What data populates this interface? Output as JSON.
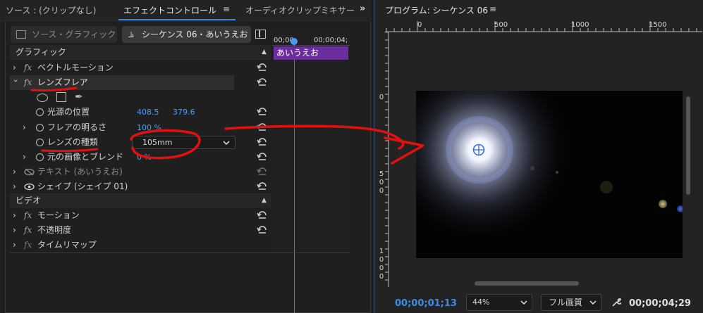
{
  "left_panel": {
    "tabs": {
      "source": "ソース : (クリップなし)",
      "effect_controls": "エフェクトコントロール",
      "audio_mixer": "オーディオクリップミキサー"
    },
    "master_clip": "ソース・グラフィック",
    "sequence_clip": "シーケンス 06・あいうえお",
    "timecodes": [
      "00;00",
      "00;00;04;"
    ],
    "clip_label": "あいうえお",
    "sections": {
      "graphic": "グラフィック",
      "video": "ビデオ"
    },
    "effects": {
      "vector_motion": "ベクトルモーション",
      "lens_flare": "レンズフレア",
      "flare_center_label": "光源の位置",
      "flare_center_x": "408.5",
      "flare_center_y": "379.6",
      "brightness_label": "フレアの明るさ",
      "brightness_value": "100 %",
      "lens_type_label": "レンズの種類",
      "lens_type_value": "105mm",
      "blend_label": "元の画像とブレンド",
      "blend_value": "0 %",
      "text_layer": "テキスト (あいうえお)",
      "shape_layer": "シェイプ (シェイプ 01)",
      "motion": "モーション",
      "opacity": "不透明度",
      "time_remap": "タイムリマップ"
    }
  },
  "program_monitor": {
    "title": "プログラム: シーケンス 06",
    "h_ruler": [
      "0",
      "500",
      "1000",
      "1500"
    ],
    "v_ruler": [
      [
        "0"
      ],
      [
        "5",
        "0",
        "0"
      ],
      [
        "1",
        "0",
        "0",
        "0"
      ]
    ],
    "current_timecode": "00;00;01;13",
    "zoom": "44%",
    "quality": "フル画質",
    "duration": "00;00;04;29"
  },
  "colors": {
    "accent_blue": "#4b9bf5",
    "timecode_blue": "#3d8ee6",
    "clip_purple": "#6a2e9e",
    "annotation_red": "#e31010"
  },
  "icons": [
    "tab-menu-icon",
    "panel-overflow-icon",
    "export-frame-icon",
    "reset-icon",
    "stopwatch-icon",
    "eye-icon",
    "ellipse-mask-icon",
    "rect-mask-icon",
    "pen-mask-icon",
    "wrench-icon",
    "chevron-down-icon"
  ]
}
